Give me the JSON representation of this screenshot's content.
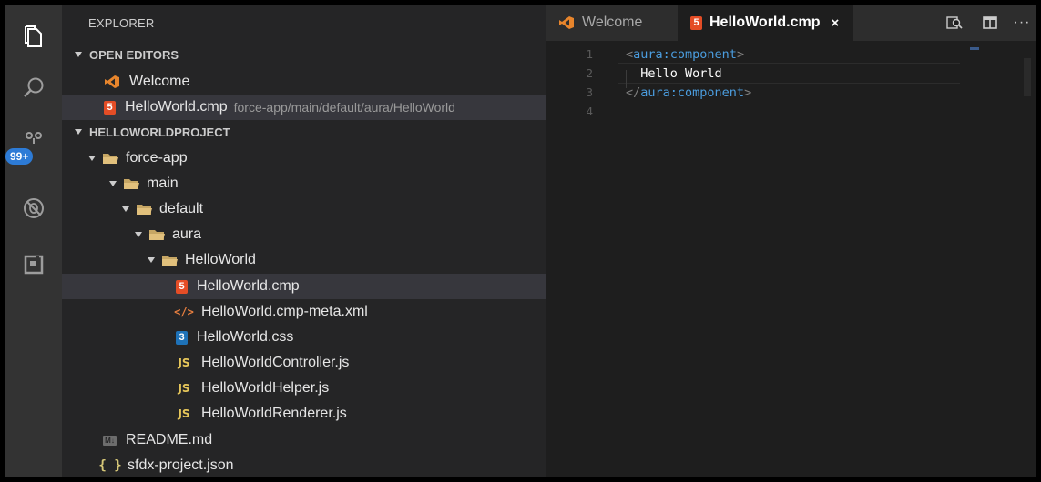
{
  "sidebar": {
    "title": "EXPLORER",
    "open_editors_label": "OPEN EDITORS",
    "open_editors": [
      {
        "label": "Welcome",
        "icon": "vscode-icon",
        "desc": ""
      },
      {
        "label": "HelloWorld.cmp",
        "icon": "html5-icon",
        "desc": "force-app/main/default/aura/HelloWorld"
      }
    ],
    "project_label": "HELLOWORLDPROJECT",
    "tree": [
      {
        "label": "force-app",
        "type": "folder",
        "depth": 0
      },
      {
        "label": "main",
        "type": "folder",
        "depth": 1
      },
      {
        "label": "default",
        "type": "folder",
        "depth": 2
      },
      {
        "label": "aura",
        "type": "folder",
        "depth": 3
      },
      {
        "label": "HelloWorld",
        "type": "folder",
        "depth": 4
      },
      {
        "label": "HelloWorld.cmp",
        "type": "html5",
        "depth": 5,
        "selected": true
      },
      {
        "label": "HelloWorld.cmp-meta.xml",
        "type": "xml",
        "depth": 5
      },
      {
        "label": "HelloWorld.css",
        "type": "css3",
        "depth": 5
      },
      {
        "label": "HelloWorldController.js",
        "type": "js",
        "depth": 5
      },
      {
        "label": "HelloWorldHelper.js",
        "type": "js",
        "depth": 5
      },
      {
        "label": "HelloWorldRenderer.js",
        "type": "js",
        "depth": 5
      },
      {
        "label": "README.md",
        "type": "md",
        "depth": 0
      },
      {
        "label": "sfdx-project.json",
        "type": "json",
        "depth": 0
      }
    ]
  },
  "activity": {
    "badge": "99+"
  },
  "icons": {
    "html5_glyph": "5",
    "css3_glyph": "3",
    "js_glyph": "JS",
    "xml_glyph": "</>",
    "md_glyph": "M↓",
    "json_glyph": "{ }"
  },
  "tabs": [
    {
      "label": "Welcome",
      "active": false
    },
    {
      "label": "HelloWorld.cmp",
      "active": true,
      "close": "×"
    }
  ],
  "editor": {
    "lines": [
      {
        "num": "1",
        "parts": [
          [
            "punct",
            "<"
          ],
          [
            "tag",
            "aura:component"
          ],
          [
            "punct",
            ">"
          ]
        ]
      },
      {
        "num": "2",
        "parts": [
          [
            "text",
            "  Hello World"
          ]
        ]
      },
      {
        "num": "3",
        "parts": [
          [
            "punct",
            "</"
          ],
          [
            "tag",
            "aura:component"
          ],
          [
            "punct",
            ">"
          ]
        ]
      },
      {
        "num": "4",
        "parts": []
      }
    ]
  },
  "colors": {
    "activity_bg": "#333333",
    "sidebar_bg": "#252526",
    "editor_bg": "#1e1e1e",
    "badge": "#2d7bd6",
    "tag": "#4b9ddf"
  }
}
